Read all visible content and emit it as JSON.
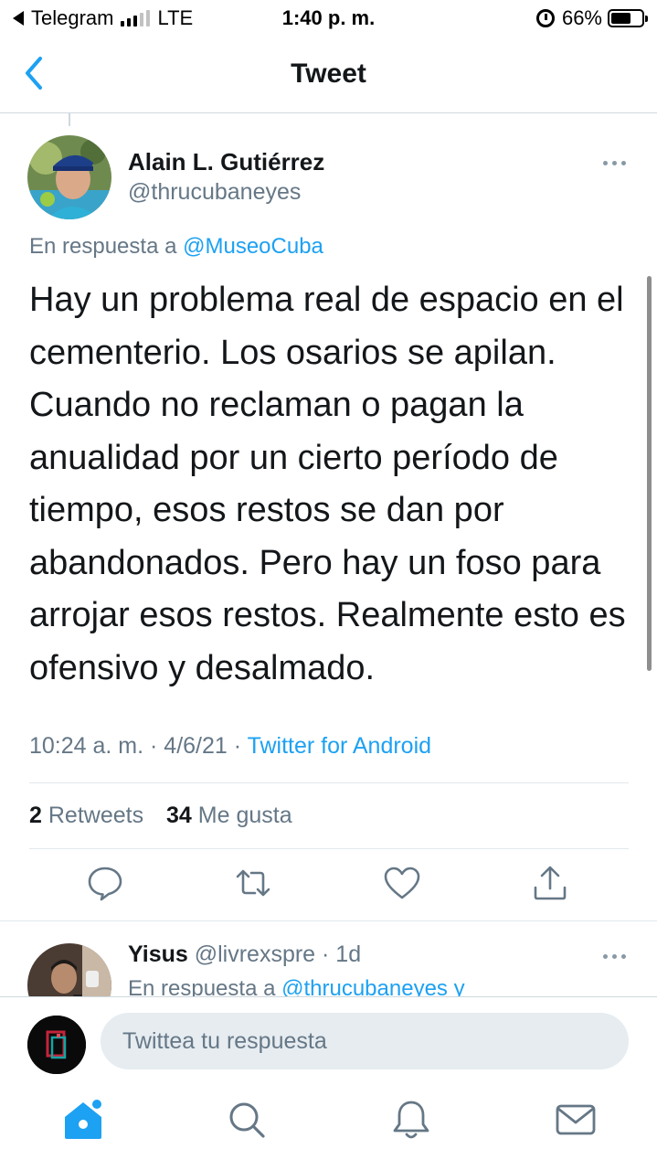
{
  "status_bar": {
    "back_app": "Telegram",
    "network": "LTE",
    "time": "1:40 p. m.",
    "battery": "66%",
    "battery_level": 0.66,
    "signal_bars_active": 3,
    "signal_bars_total": 5
  },
  "nav": {
    "title": "Tweet",
    "back_icon": "chevron-left-icon"
  },
  "tweet": {
    "author_name": "Alain L. Gutiérrez",
    "author_handle": "@thrucubaneyes",
    "reply_prefix": "En respuesta a ",
    "reply_mention": "@MuseoCuba",
    "text": "Hay un problema real de espacio en el cementerio.  Los osarios se apilan. Cuando no reclaman o pagan la anualidad por un cierto período de tiempo, esos restos se dan por abandonados. Pero hay un foso para arrojar esos restos. Realmente esto es ofensivo y desalmado.",
    "time_date": "10:24 a. m. · 4/6/21 · ",
    "source": "Twitter for Android",
    "retweets_count": "2",
    "retweets_label": "Retweets",
    "likes_count": "34",
    "likes_label": "Me gusta"
  },
  "actions": [
    "reply-icon",
    "retweet-icon",
    "like-icon",
    "share-icon"
  ],
  "reply": {
    "name": "Yisus",
    "meta": "@livrexspre · 1d",
    "prefix": "En respuesta a ",
    "mention": "@thrucubaneyes y"
  },
  "composer": {
    "placeholder": "Twittea tu respuesta"
  },
  "tabbar": [
    "home-icon",
    "search-icon",
    "notifications-icon",
    "messages-icon"
  ],
  "colors": {
    "accent": "#1da1f2",
    "secondary_text": "#657786",
    "input_bg": "#e6ecf0"
  }
}
